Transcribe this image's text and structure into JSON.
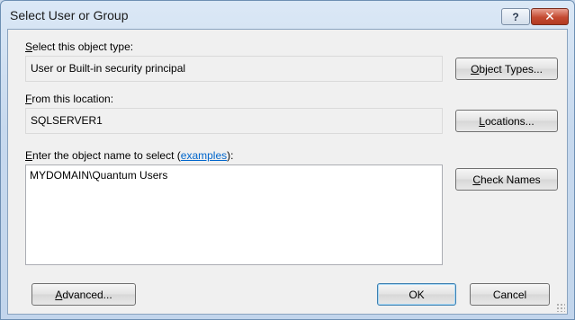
{
  "window": {
    "title": "Select User or Group",
    "help_label": "?",
    "close_label": "✕"
  },
  "object_type": {
    "label_accel": "S",
    "label_rest": "elect this object type:",
    "value": "User or Built-in security principal",
    "button_accel": "O",
    "button_rest": "bject Types..."
  },
  "location": {
    "label_accel": "F",
    "label_rest": "rom this location:",
    "value": "SQLSERVER1",
    "button_accel": "L",
    "button_rest": "ocations..."
  },
  "object_name": {
    "label_accel": "E",
    "label_pre": "nter the object name to select (",
    "link_text": "examples",
    "label_post": "):",
    "value": "MYDOMAIN\\Quantum Users",
    "check_accel": "C",
    "check_rest": "heck Names"
  },
  "footer": {
    "advanced_accel": "A",
    "advanced_rest": "dvanced...",
    "ok_label": "OK",
    "cancel_label": "Cancel"
  }
}
